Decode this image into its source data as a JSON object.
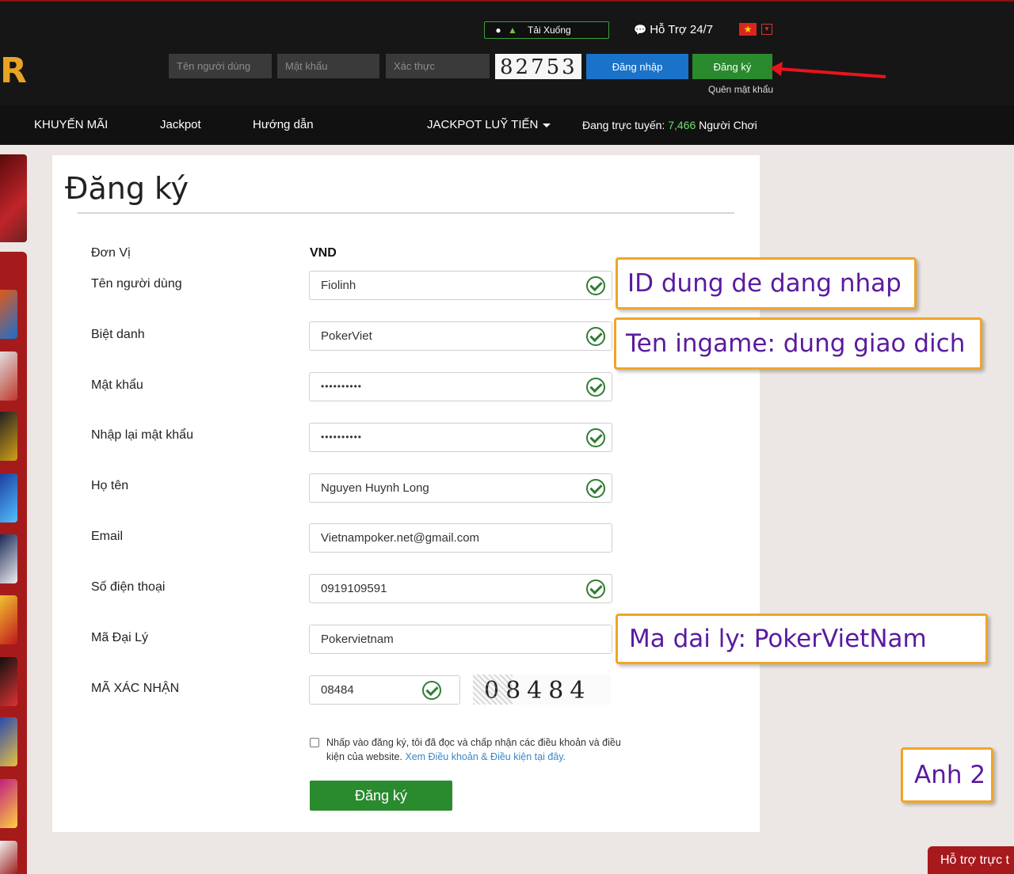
{
  "header": {
    "logo_letter": "R",
    "download_label": "Tải Xuống",
    "support_label": "Hỗ Trợ 24/7",
    "flag": "★",
    "username_placeholder": "Tên người dùng",
    "password_placeholder": "Mật khẩu",
    "captcha_placeholder": "Xác thực",
    "captcha_text": "82753",
    "login_label": "Đăng nhập",
    "register_label": "Đăng ký",
    "forgot_label": "Quên mật khẩu"
  },
  "nav": {
    "items": [
      "KHUYẾN MÃI",
      "Jackpot",
      "Hướng dẫn",
      "JACKPOT LUỸ TIẾN"
    ],
    "online_prefix": "Đang trực tuyến: ",
    "online_count": "7,466",
    "online_suffix": " Người Chơi"
  },
  "form": {
    "title": "Đăng ký",
    "fields": {
      "unit": {
        "label": "Đơn Vị",
        "value": "VND"
      },
      "username": {
        "label": "Tên người dùng",
        "value": "Fiolinh"
      },
      "nickname": {
        "label": "Biệt danh",
        "value": "PokerViet"
      },
      "password": {
        "label": "Mật khẩu",
        "value": "••••••••••"
      },
      "password_confirm": {
        "label": "Nhập lại mật khẩu",
        "value": "••••••••••"
      },
      "fullname": {
        "label": "Họ tên",
        "value": "Nguyen Huynh Long"
      },
      "email": {
        "label": "Email",
        "value": "Vietnampoker.net@gmail.com"
      },
      "phone": {
        "label": "Số điện thoại",
        "value": "0919109591"
      },
      "agent": {
        "label": "Mã Đại Lý",
        "value": "Pokervietnam"
      },
      "captcha": {
        "label": "MÃ XÁC NHẬN",
        "value": "08484",
        "image_text": "08484"
      }
    },
    "terms_text": "Nhấp vào đăng ký, tôi đã đọc và chấp nhận các điều khoản và điều kiện của website. ",
    "terms_link": "Xem Điều khoản & Điều kiện tại đây.",
    "submit_label": "Đăng ký"
  },
  "annotations": {
    "id_note": "ID dung de dang nhap",
    "ingame_note": "Ten ingame: dung giao dich",
    "agent_note": "Ma dai ly:  PokerVietNam",
    "image_tag": "Anh 2"
  },
  "chat_tab": "Hỗ trợ trực t",
  "colors": {
    "header_bg": "#161616",
    "login_blue": "#1b72c9",
    "register_green": "#2a8a2e",
    "callout_border": "#f0a526",
    "callout_text": "#5a1aa0",
    "sidebar_red": "#a51b1b"
  }
}
